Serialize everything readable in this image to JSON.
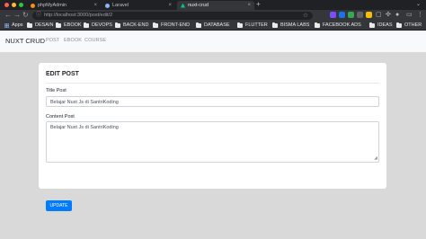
{
  "browser": {
    "tabs": [
      {
        "title": "phpMyAdmin",
        "active": false
      },
      {
        "title": "Laravel",
        "active": false
      },
      {
        "title": "nuxt-crud",
        "active": true
      }
    ],
    "url": "http://localhost:3000/post/edit/2",
    "bookmarks": [
      "Apps",
      "DESAIN",
      "EBOOK",
      "DEVOPS",
      "BACK-END",
      "FRONT-END",
      "DATABASE",
      "FLUTTER",
      "BISMA LABS",
      "FACEBOOK ADS",
      "IDEAS",
      "OTHER"
    ]
  },
  "navbar": {
    "brand": "NUXT CRUD",
    "links": [
      "POST",
      "EBOOK",
      "COURSE"
    ]
  },
  "card": {
    "title": "EDIT POST",
    "title_label": "Title Post",
    "title_value": "Belajar Nuxt Js di SantriKoding",
    "content_label": "Content Post",
    "content_value": "Belajar Nuxt Js di SantriKoding",
    "button": "UPDATE"
  },
  "colors": {
    "primary": "#007bff",
    "chrome_dark": "#202124",
    "chrome_toolbar": "#35363a",
    "page_bg": "#d9d9d9"
  }
}
